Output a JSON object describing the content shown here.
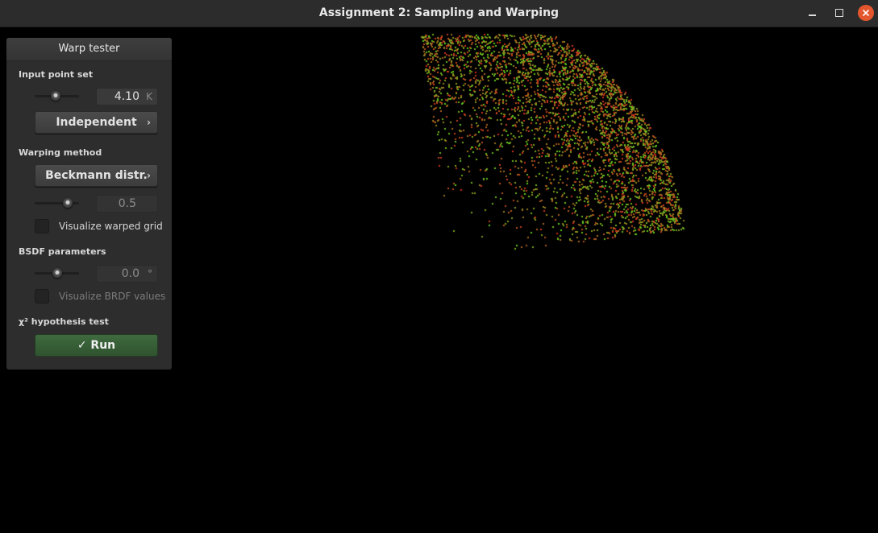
{
  "window": {
    "title": "Assignment 2: Sampling and Warping"
  },
  "panel": {
    "title": "Warp tester",
    "input_point_set": {
      "label": "Input point set",
      "count_value": "4.10",
      "count_unit": "K",
      "slider_level": 0.47,
      "point_type": "Independent"
    },
    "warping_method": {
      "label": "Warping method",
      "method": "Beckmann distr.",
      "param_value": "0.5",
      "slider_level": 0.75,
      "visualize_grid_label": "Visualize warped grid",
      "visualize_grid_checked": false
    },
    "bsdf_parameters": {
      "label": "BSDF parameters",
      "param_value": "0.0",
      "param_unit": "°",
      "slider_level": 0.5,
      "visualize_brdf_label": "Visualize BRDF values",
      "visualize_brdf_checked": false
    },
    "hypothesis_test": {
      "label": "χ² hypothesis test",
      "run_label": "✓ Run"
    }
  },
  "plot": {
    "point_count": 4100,
    "colors": {
      "start": "#d22a1e",
      "end": "#5ad21e"
    }
  }
}
